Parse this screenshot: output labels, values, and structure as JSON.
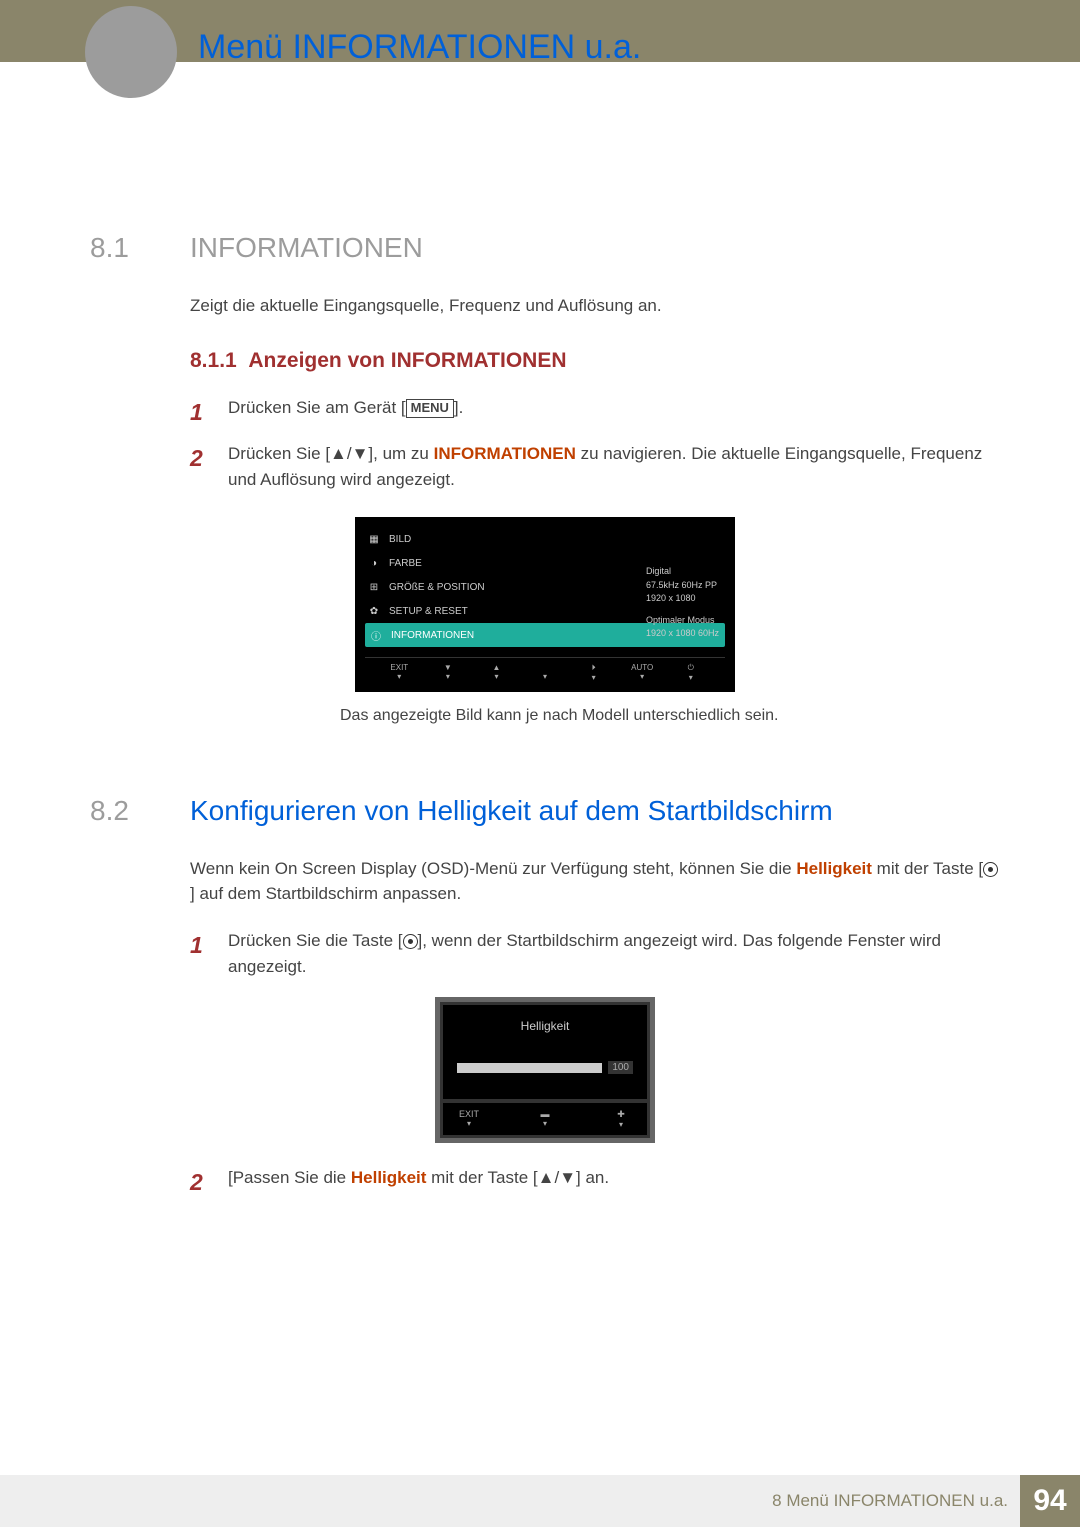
{
  "header": {
    "chapter_title": "Menü INFORMATIONEN u.a."
  },
  "section1": {
    "num": "8.1",
    "title": "INFORMATIONEN",
    "intro": "Zeigt die aktuelle Eingangsquelle, Frequenz und Auflösung an.",
    "sub_num": "8.1.1",
    "sub_title": "Anzeigen von INFORMATIONEN",
    "step1_num": "1",
    "step1_a": "Drücken Sie am Gerät [",
    "step1_menu": "MENU",
    "step1_b": "].",
    "step2_num": "2",
    "step2_a": "Drücken Sie [",
    "step2_arrows": "▲/▼",
    "step2_b": "], um zu ",
    "step2_hl": "INFORMATIONEN",
    "step2_c": " zu navigieren. Die aktuelle Eingangsquelle, Frequenz und Auflösung wird angezeigt.",
    "caption": "Das angezeigte Bild kann je nach Modell unterschiedlich sein."
  },
  "osd1": {
    "items": [
      "BILD",
      "FARBE",
      "GRÖßE & POSITION",
      "SETUP & RESET",
      "INFORMATIONEN"
    ],
    "info_l1": "Digital",
    "info_l2": "67.5kHz 60Hz PP",
    "info_l3": "1920 x 1080",
    "info_l4": "Optimaler Modus",
    "info_l5": "1920 x 1080 60Hz",
    "f_exit": "EXIT",
    "f_down": "▼",
    "f_up": "▲",
    "f_enter": "⏵",
    "f_auto": "AUTO",
    "f_power": "⏻",
    "f_arrow": "▾"
  },
  "section2": {
    "num": "8.2",
    "title": "Konfigurieren von Helligkeit auf dem Startbildschirm",
    "intro_a": "Wenn kein On Screen Display (OSD)-Menü zur Verfügung steht, können Sie die ",
    "intro_hl": "Helligkeit",
    "intro_b": " mit der Taste [",
    "intro_c": "] auf dem Startbildschirm anpassen.",
    "step1_num": "1",
    "step1_a": "Drücken Sie die Taste [",
    "step1_b": "], wenn der Startbildschirm angezeigt wird. Das folgende Fenster wird angezeigt.",
    "step2_num": "2",
    "step2_a": "[Passen Sie die ",
    "step2_hl": "Helligkeit",
    "step2_b": " mit der Taste [",
    "step2_arrows": "▲/▼",
    "step2_c": "] an."
  },
  "osd2": {
    "title": "Helligkeit",
    "value": "100",
    "f_exit": "EXIT",
    "f_minus": "▬",
    "f_plus": "✚",
    "f_arrow": "▾"
  },
  "footer": {
    "text": "8 Menü INFORMATIONEN u.a.",
    "page": "94"
  }
}
